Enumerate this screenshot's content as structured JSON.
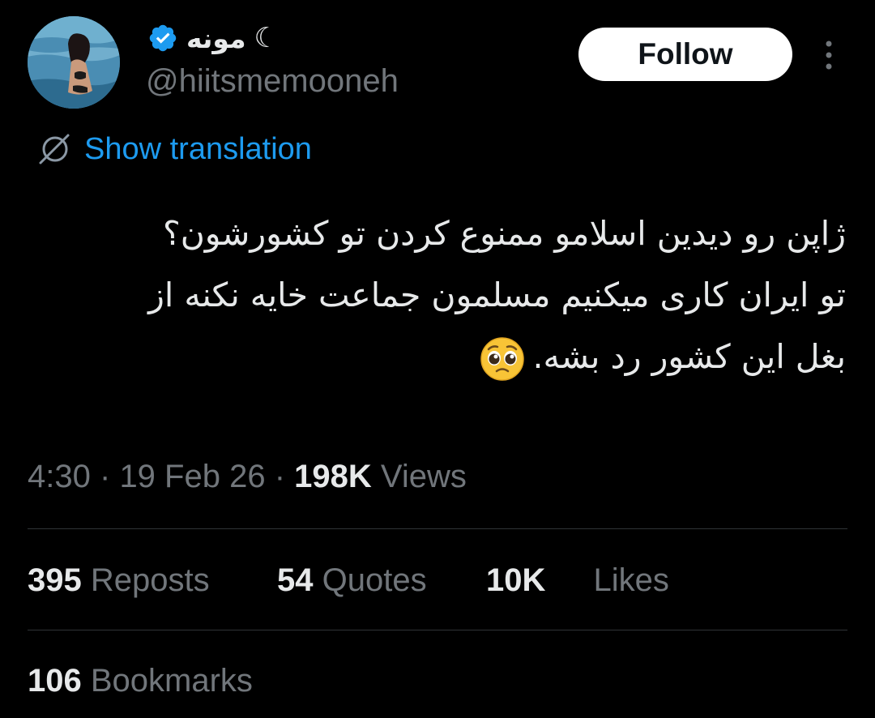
{
  "author": {
    "display_name": "مونه",
    "moon_symbol": "☾",
    "handle": "@hiitsmemooneh",
    "verified_color": "#1d9bf0",
    "avatar_icon": "profile-photo"
  },
  "actions": {
    "follow_label": "Follow",
    "more_icon": "more-vertical-icon"
  },
  "translation": {
    "label": "Show translation",
    "icon": "globe-translate-icon"
  },
  "tweet": {
    "lines": [
      "ژاپن رو دیدین اسلامو ممنوع کردن تو کشورشون؟",
      "تو ایران کاری میکنیم مسلمون جماعت خایه نکنه از",
      "بغل این کشور رد بشه."
    ],
    "emoji": "pleading-face-emoji"
  },
  "meta": {
    "time": "4:30",
    "separator": "·",
    "date": "19 Feb 26",
    "views_count": "198K",
    "views_label": "Views"
  },
  "stats": {
    "reposts_count": "395",
    "reposts_label": "Reposts",
    "quotes_count": "54",
    "quotes_label": "Quotes",
    "likes_count": "10K",
    "likes_label": "Likes",
    "bookmarks_count": "106",
    "bookmarks_label": "Bookmarks"
  },
  "colors": {
    "background": "#000000",
    "text_primary": "#e7e9ea",
    "text_secondary": "#71767b",
    "accent": "#1d9bf0",
    "divider": "#2f3336"
  }
}
